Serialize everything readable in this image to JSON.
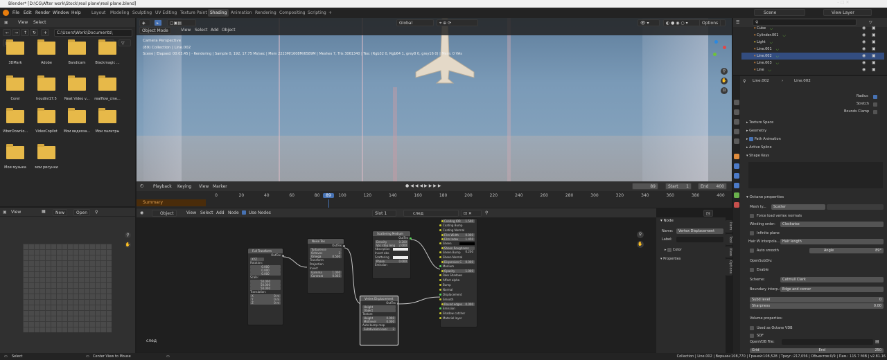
{
  "window": {
    "title": "Blender* [D:\\CG\\After work\\Stock\\real plane\\real plane.blend]"
  },
  "menubar": {
    "items": [
      "File",
      "Edit",
      "Render",
      "Window",
      "Help"
    ],
    "workspaces": [
      "Layout",
      "Modeling",
      "Sculpting",
      "UV Editing",
      "Texture Paint",
      "Shading",
      "Animation",
      "Rendering",
      "Compositing",
      "Scripting"
    ],
    "add_tab": "+",
    "scene": "Scene",
    "view_layer": "View Layer"
  },
  "filebrowser": {
    "view": "View",
    "select": "Select",
    "path": "C:\\Users\\Work\\Documents\\",
    "folders": [
      "3DMark",
      "Adobe",
      "Bandicam",
      "Blackmagic ...",
      "Corel",
      "houdini17.5",
      "Neat Video v...",
      "realflow_cine...",
      "ViberDownlo...",
      "VideoCopilot",
      "Мои видеоза...",
      "Мои палитры",
      "Мои музыка",
      "мои рисунки"
    ]
  },
  "imageeditor": {
    "view": "View",
    "new": "New",
    "open": "Open"
  },
  "viewport": {
    "mode": "Object Mode",
    "menus": [
      "View",
      "Select",
      "Add",
      "Object"
    ],
    "orientation": "Global",
    "options": "Options",
    "overlay_line1": "Camera Perspective",
    "overlay_line2": "(89) Collection | Line.002",
    "overlay_line3": "Scene | Elapsed: 00:03.45 | - Rendering | Sample 0, 192, 17.75 Ms/sec | Mem 2223M/1608M/6589M | Meshes 7, Tris 3061340 | Tex: (Rgb32 0, Rgb64 1, grey8 0, grey16 0) | Mem: 0 VAs"
  },
  "timeline": {
    "menus": [
      "Playback",
      "Keying",
      "View",
      "Marker"
    ],
    "current": "89",
    "start_label": "Start",
    "start": "1",
    "end_label": "End",
    "end": "400",
    "summary": "Summary",
    "ticks": [
      "0",
      "20",
      "40",
      "60",
      "80",
      "89",
      "100",
      "120",
      "140",
      "160",
      "180",
      "200",
      "220",
      "240",
      "260",
      "280",
      "300",
      "320",
      "340",
      "360",
      "380",
      "400"
    ]
  },
  "nodeeditor": {
    "type": "Object",
    "menus": [
      "View",
      "Select",
      "Add",
      "Node"
    ],
    "use_nodes": "Use Nodes",
    "slot": "Slot 1",
    "material": "след",
    "footer_label": "след",
    "tabs": [
      "Item",
      "Tool",
      "View",
      "Options"
    ],
    "node_panel": {
      "title": "Node",
      "name_label": "Name:",
      "name": "Vertex Displacement",
      "label_label": "Label:",
      "color": "Color",
      "properties": "Properties"
    },
    "nodes": {
      "fulltransform": {
        "title": "Full Transform",
        "out": "OutTex",
        "mode": "XYZ",
        "rotation": "Rotation:",
        "r": [
          "0.000",
          "0.000",
          "0.000"
        ],
        "scale": "Scale:",
        "s": [
          "50.000",
          "50.000",
          "50.000"
        ],
        "translation": "Translation:",
        "tr": [
          "X",
          "Y",
          "Z"
        ],
        "tv": [
          "0 m",
          "0 m",
          "0 m"
        ]
      },
      "noise": {
        "title": "Noise Tex",
        "out": "OutTex",
        "type": "Turbulence",
        "octaves": "Octaves",
        "octaves_v": "3",
        "omega": "Omega",
        "omega_v": "0.500",
        "transform": "Transform",
        "projection": "Projection",
        "invert": "Invert",
        "gamma": "Gamma",
        "gamma_v": "1.000",
        "contrast": "Contrast",
        "contrast_v": "0.003"
      },
      "scatter": {
        "title": "Scattering Medium",
        "out": "OutTex",
        "density": "Density",
        "density_v": "0.200",
        "vol": "Vol. step leng",
        "vol_v": "2.000",
        "absorb": "Absorption",
        "invabs": "Invert abs.",
        "scattering": "Scattering",
        "phase": "Phase",
        "phase_v": "0.000",
        "emission": "Emission"
      },
      "vdisp": {
        "title": "Vertex Displacement",
        "out": "OutTex",
        "height": "Height",
        "object": "Object",
        "texture": "Texture",
        "h": "Height",
        "h_v": "0.000",
        "mid": "Mid level",
        "mid_v": "0.000",
        "auto": "Auto bump map",
        "sub": "Subdivision level",
        "sub_v": "2"
      },
      "material": {
        "rows": [
          "Coating IOR",
          "Coating Bump",
          "Coating Normal",
          "Film Width",
          "Film Index",
          "Sheen",
          "Sheen Roughness",
          "Sheen Bump",
          "Sheen Normal",
          "Dispersion C.",
          "Medium",
          "Opacity",
          "Fake Shadows",
          "Affect alpha",
          "Bump",
          "Normal",
          "Displacement",
          "Smooth",
          "Round edges",
          "Emission",
          "Shadow catcher",
          "Material layer"
        ],
        "vals": [
          "1.500",
          "",
          "",
          "0.000",
          "1.450",
          "",
          "0.200",
          "",
          "",
          "0.000",
          "",
          "1.000",
          "",
          "",
          "",
          "",
          "",
          "",
          "0.000",
          "",
          "",
          ""
        ]
      }
    }
  },
  "outliner": {
    "items": [
      "Cube",
      "Cylinder.001",
      "Light",
      "Line.001",
      "Line.002",
      "Line.003",
      "Line"
    ]
  },
  "properties": {
    "obj": "Line.002",
    "data": "Line.002",
    "radius": "Radius",
    "stretch": "Stretch",
    "bounds": "Bounds Clamp",
    "sections": [
      "Texture Space",
      "Geometry",
      "Path Animation",
      "Active Spline",
      "Shape Keys"
    ],
    "octane": "Octane properties",
    "mesh_label": "Mesh ty...",
    "mesh_val": "Scatter",
    "force": "Force load vertex normals",
    "winding_label": "Winding order:",
    "winding_val": "Clockwise",
    "infinite": "Infinite plane",
    "hair_label": "Hair W interpola...",
    "hair_val": "Hair length",
    "auto_smooth": "Auto smooth",
    "angle": "Angle",
    "angle_v": "89°",
    "opensubdiv": "OpenSubDiv:",
    "enable": "Enable",
    "scheme_label": "Scheme:",
    "scheme_val": "Catmull Clark",
    "boundary_label": "Boundary interp.:",
    "boundary_val": "Edge and corner",
    "subd": "Subd level",
    "subd_v": "0",
    "sharp": "Sharpness",
    "sharp_v": "0.00",
    "volume": "Volume properties:",
    "vdb": "Used as Octane VDB",
    "sdf": "SDF",
    "openvdb": "OpenVDB File:",
    "grid": "Grid",
    "end": "End",
    "end_v": "250"
  },
  "statusbar": {
    "select": "Select",
    "center": "Center View to Mouse",
    "stats": "Collection | Line.002 | Вершин:108,770 | Граней:108,528 | Треуг.:217,056 | Объектов:0/9 | Пам.: 115.7 MiB | v2.81.16"
  },
  "colors": {
    "accent": "#4772b3",
    "header": "#303030",
    "panel": "#2b2b2b",
    "folder": "#e7b949"
  }
}
